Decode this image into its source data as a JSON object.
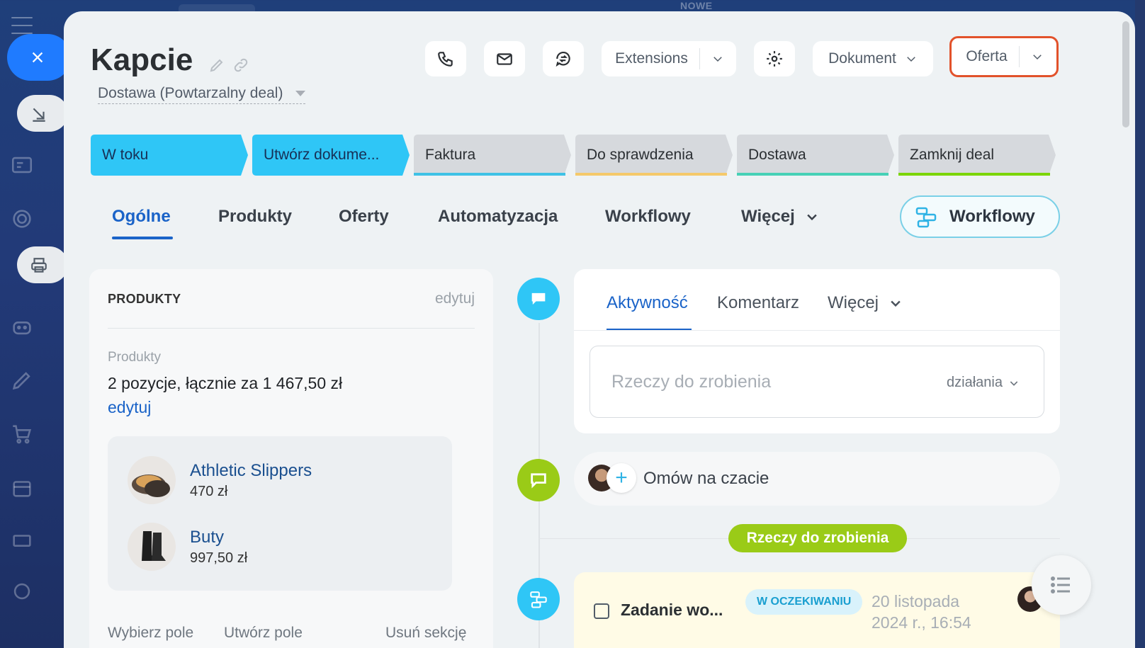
{
  "top": {
    "label": "NOWE"
  },
  "deal": {
    "title": "Kapcie",
    "pipeline": "Dostawa (Powtarzalny deal)"
  },
  "toolbar": {
    "extensions_label": "Extensions",
    "document_label": "Dokument",
    "offer_label": "Oferta"
  },
  "stages": [
    {
      "label": "W toku",
      "color": "#2fc6f6"
    },
    {
      "label": "Utwórz dokume...",
      "color": "#2fc6f6"
    },
    {
      "label": "Faktura",
      "color": "#3fc2e6"
    },
    {
      "label": "Do sprawdzenia",
      "color": "#f5c96a"
    },
    {
      "label": "Dostawa",
      "color": "#47d1b6"
    },
    {
      "label": "Zamknij deal",
      "color": "#7bd500"
    }
  ],
  "tabs": [
    "Ogólne",
    "Produkty",
    "Oferty",
    "Automatyzacja",
    "Workflowy",
    "Więcej"
  ],
  "workflow_button": "Workflowy",
  "products_card": {
    "header": "PRODUKTY",
    "edit_label": "edytuj",
    "field_label": "Produkty",
    "summary": "2 pozycje, łącznie za 1 467,50 zł",
    "edit_link": "edytuj",
    "items": [
      {
        "name": "Athletic Slippers",
        "price": "470 zł"
      },
      {
        "name": "Buty",
        "price": "997,50 zł"
      }
    ],
    "footer": [
      "Wybierz pole",
      "Utwórz pole",
      "Usuń sekcję"
    ]
  },
  "activity": {
    "tabs": [
      "Aktywność",
      "Komentarz",
      "Więcej"
    ],
    "todo_placeholder": "Rzeczy do zrobienia",
    "actions_label": "działania",
    "chat_label": "Omów na czacie",
    "todo_badge": "Rzeczy do zrobienia",
    "task": {
      "title": "Zadanie wo...",
      "status": "W OCZEKIWANIU",
      "date_line1": "20 listopada",
      "date_line2": "2024 r., 16:54"
    }
  },
  "colors": {
    "accent": "#1a63c8",
    "offer_border": "#e2522b",
    "todo_green": "#9acb17"
  }
}
